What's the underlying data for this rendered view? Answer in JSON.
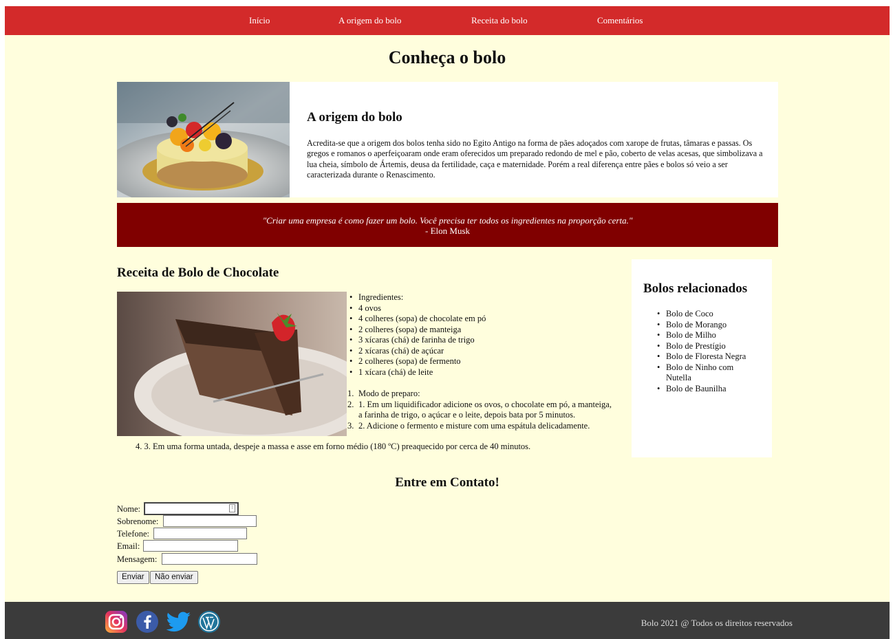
{
  "nav": {
    "items": [
      "Início",
      "A origem do bolo",
      "Receita do bolo",
      "Comentários"
    ]
  },
  "page_title": "Conheça o bolo",
  "origin": {
    "title": "A origem do bolo",
    "text": "Acredita-se que a origem dos bolos tenha sido no Egito Antigo na forma de pães adoçados com xarope de frutas, tâmaras e passas. Os gregos e romanos o aperfeiçoaram onde eram oferecidos um preparado redondo de mel e pão, coberto de velas acesas, que simbolizava a lua cheia, símbolo de Ártemis, deusa da fertilidade, caça e maternidade. Porém a real diferença entre pães e bolos só veio a ser caracterizada durante o Renascimento."
  },
  "quote": {
    "text": "\"Criar uma empresa é como fazer um bolo. Você precisa ter todos os ingredientes na proporção certa.\"",
    "author": "- Elon Musk"
  },
  "recipe": {
    "title": "Receita de Bolo de Chocolate",
    "ingredients": [
      "Ingredientes:",
      "4 ovos",
      "4 colheres (sopa) de chocolate em pó",
      "2 colheres (sopa) de manteiga",
      "3 xícaras (chá) de farinha de trigo",
      "2 xícaras (chá) de açúcar",
      "2 colheres (sopa) de fermento",
      "1 xícara (chá) de leite"
    ],
    "steps": [
      {
        "n": "1.",
        "text": "Modo de preparo:"
      },
      {
        "n": "2.",
        "text": "1. Em um liquidificador adicione os ovos, o chocolate em pó, a manteiga, a farinha de trigo, o açúcar e o leite, depois bata por 5 minutos."
      },
      {
        "n": "3.",
        "text": "2. Adicione o fermento e misture com uma espátula delicadamente."
      },
      {
        "n": "4.",
        "text": "3. Em uma forma untada, despeje a massa e asse em forno médio (180 ºC) preaquecido por cerca de 40 minutos."
      }
    ]
  },
  "related": {
    "title": "Bolos relacionados",
    "items": [
      "Bolo de Coco",
      "Bolo de Morango",
      "Bolo de Milho",
      "Bolo de Prestígio",
      "Bolo de Floresta Negra",
      "Bolo de Ninho com Nutella",
      "Bolo de Baunilha"
    ]
  },
  "contact": {
    "title": "Entre em Contato!",
    "labels": {
      "nome": "Nome:",
      "sobrenome": "Sobrenome:",
      "telefone": "Telefone:",
      "email": "Email:",
      "mensagem": "Mensagem:"
    },
    "submit": "Enviar",
    "reset": "Não enviar"
  },
  "footer": {
    "copyright": "Bolo 2021 @ Todos os direitos reservados",
    "social_icons": [
      "instagram-icon",
      "facebook-icon",
      "twitter-icon",
      "wordpress-icon"
    ]
  },
  "colors": {
    "nav": "#d32a2a",
    "background": "#fffedd",
    "quote_bg": "#800000",
    "footer": "#3b3b3b"
  }
}
